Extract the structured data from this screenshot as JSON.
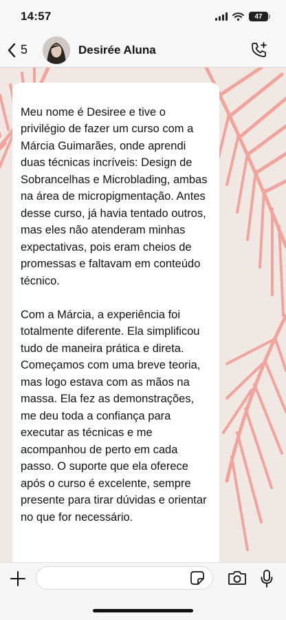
{
  "status_bar": {
    "time": "14:57",
    "battery": "47"
  },
  "header": {
    "back_count": "5",
    "contact_name": "Desirée Aluna"
  },
  "message": {
    "text": "Meu nome é Desiree e tive o privilégio de fazer um curso com a Márcia Guimarães, onde aprendi duas técnicas incríveis: Design de Sobrancelhas e Microblading, ambas na área de micropigmentação. Antes desse curso, já havia tentado outros, mas eles não atenderam minhas expectativas, pois eram cheios de promessas e faltavam em conteúdo técnico.\n\nCom a Márcia, a experiência foi totalmente diferente. Ela simplificou tudo de maneira prática e direta. Começamos com uma breve teoria, mas logo estava com as mãos na massa. Ela fez as demonstrações, me deu toda a confiança para executar as técnicas e me acompanhou de perto em cada passo. O suporte que ela oferece após o curso é excelente, sempre presente para tirar dúvidas e orientar no que for necessário."
  },
  "composer": {
    "placeholder": ""
  },
  "icons": {
    "back": "chevron-left-icon",
    "call": "phone-plus-icon",
    "attach": "plus-icon",
    "sticker": "sticker-icon",
    "camera": "camera-icon",
    "mic": "microphone-icon"
  },
  "colors": {
    "wallpaper_leaf": "#ec8f86",
    "bubble": "#ffffff",
    "bar": "#f7f7f7"
  }
}
